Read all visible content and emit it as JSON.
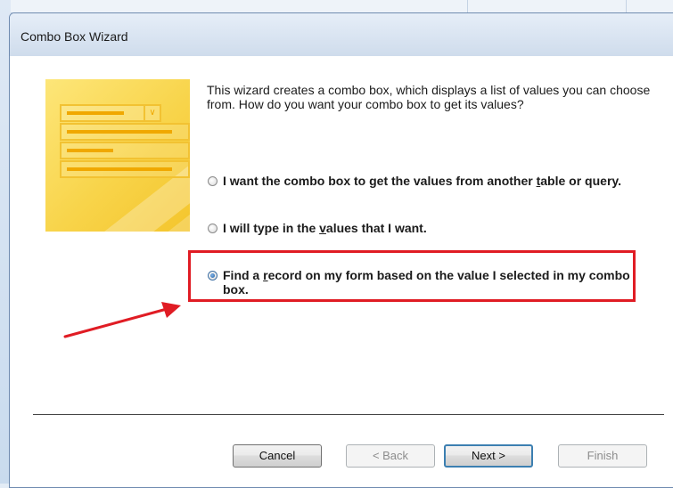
{
  "window": {
    "title": "Combo Box Wizard"
  },
  "intro_text": "This wizard creates a combo box, which displays a list of values you can choose from.  How do you want your combo box to get its values?",
  "options": [
    {
      "label_before": "I want the combo box to get the values from another ",
      "label_key": "t",
      "label_after_key": "able or query.",
      "selected": false
    },
    {
      "label_before": "I will type in the ",
      "label_key": "v",
      "label_after_key": "alues that I want.",
      "selected": false
    },
    {
      "label_before": "Find a ",
      "label_key": "r",
      "label_after_key": "ecord on my form based on the value I selected in my combo box.",
      "selected": true
    }
  ],
  "buttons": {
    "cancel": "Cancel",
    "back": "< Back",
    "next": "Next >",
    "finish": "Finish"
  },
  "colors": {
    "highlight": "#e01c24",
    "arrow": "#e01c24",
    "illustration": "#f8d44a"
  },
  "icons": {
    "illustration": "combo-box-wizard-illustration",
    "annotation": "red-arrow-icon"
  }
}
